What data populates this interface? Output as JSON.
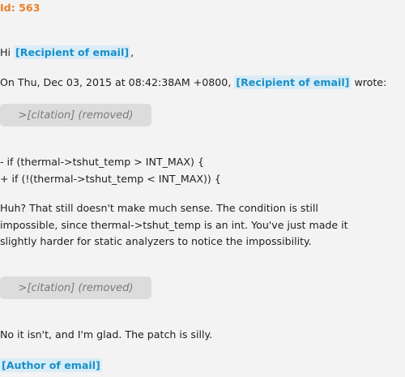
{
  "header": {
    "id_label": "Id: 563"
  },
  "email": {
    "greeting_prefix": "Hi ",
    "greeting_recipient": "[Recipient of email]",
    "greeting_suffix": ",",
    "quote_intro_prefix": "On Thu, Dec 03, 2015 at 08:42:38AM +0800, ",
    "quote_intro_recipient": "[Recipient of email]",
    "quote_intro_suffix": " wrote:",
    "citation_1": ">[citation] (removed)",
    "code_line_1": "- if (thermal->tshut_temp > INT_MAX) {",
    "code_line_2": "+ if (!(thermal->tshut_temp < INT_MAX)) {",
    "reply_line_1": "Huh? That still doesn't make much sense. The condition is still",
    "reply_line_2": "impossible, since thermal->tshut_temp is an int. You've just made it",
    "reply_line_3": "slightly harder for static analyzers to notice the impossibility.",
    "citation_2": ">[citation] (removed)",
    "closing_line": "No it isn't, and I'm glad. The patch is silly.",
    "signature": "[Author of email]"
  },
  "colors": {
    "id_color": "#e8802d",
    "tag_text": "#1a8fc8",
    "tag_bg": "#d9edf7",
    "citation_bg": "#dcdcdc",
    "background": "#f3f3f3"
  }
}
